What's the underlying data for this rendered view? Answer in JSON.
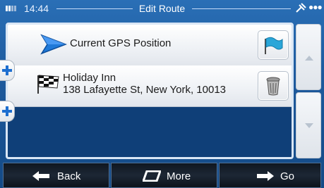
{
  "status": {
    "time": "14:44",
    "title": "Edit Route",
    "menu_dots": "●●●"
  },
  "route": {
    "items": [
      {
        "label": "Current GPS Position",
        "action_icon": "flag-icon"
      },
      {
        "name": "Holiday Inn",
        "address": "138 Lafayette St, New York, 10013",
        "action_icon": "trash-icon"
      }
    ]
  },
  "toolbar": {
    "back_label": "Back",
    "more_label": "More",
    "go_label": "Go"
  },
  "colors": {
    "accent": "#1d5a9e",
    "plus_blue": "#1e6fd0"
  }
}
